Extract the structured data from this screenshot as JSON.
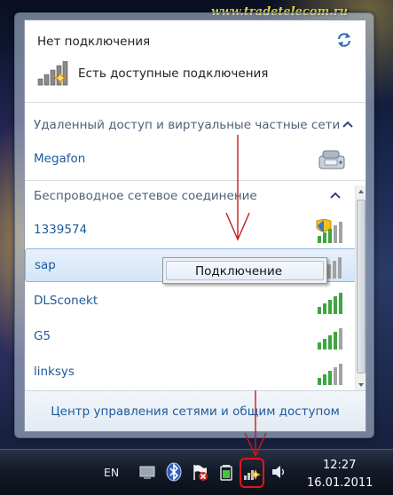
{
  "watermark": "www.tradetelecom.ru",
  "flyout": {
    "status_title": "Нет подключения",
    "available_label": "Есть доступные подключения",
    "groups": [
      {
        "header": "Удаленный доступ и виртуальные частные сети",
        "collapse_icon": "chevron-up-icon"
      },
      {
        "header": "Беспроводное сетевое соединение",
        "collapse_icon": "chevron-up-icon"
      }
    ],
    "dialup": {
      "label": "Megafon",
      "icon": "modem-phone-icon"
    },
    "networks": [
      {
        "label": "1339574",
        "signal": 3,
        "secured": false,
        "shield": true
      },
      {
        "label": "sap",
        "signal": 2,
        "selected": true
      },
      {
        "label": "DLSconekt",
        "signal": 5
      },
      {
        "label": "G5",
        "signal": 4
      },
      {
        "label": "linksys",
        "signal": 3
      }
    ],
    "footer_link": "Центр управления сетями и общим доступом"
  },
  "context_menu": {
    "item": "Подключение"
  },
  "taskbar": {
    "language": "EN",
    "time": "12:27",
    "date": "16.01.2011",
    "tray_icons": [
      "network-adapter-icon",
      "bluetooth-icon",
      "action-center-flag-icon",
      "battery-icon",
      "network-no-connection-icon",
      "volume-icon"
    ]
  },
  "colors": {
    "link": "#1d5a9c",
    "group_header": "#50607a",
    "annotation_red": "#e0161c",
    "watermark": "#f2e24a"
  }
}
